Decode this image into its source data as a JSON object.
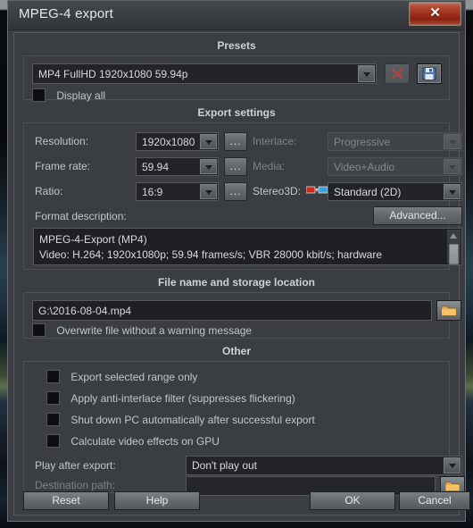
{
  "window": {
    "title": "MPEG-4 export",
    "close_label": "✕"
  },
  "presets": {
    "group_title": "Presets",
    "selected": "MP4 FullHD 1920x1080 59.94p",
    "delete_icon": "x-icon",
    "save_icon": "floppy-disk-icon",
    "display_all_label": "Display all",
    "display_all_checked": false
  },
  "export_settings": {
    "group_title": "Export settings",
    "resolution_label": "Resolution:",
    "resolution_value": "1920x1080",
    "frame_rate_label": "Frame rate:",
    "frame_rate_value": "59.94",
    "ratio_label": "Ratio:",
    "ratio_value": "16:9",
    "dots_label": "...",
    "interlace_label": "Interlace:",
    "interlace_value": "Progressive",
    "media_label": "Media:",
    "media_value": "Video+Audio",
    "stereo3d_label": "Stereo3D:",
    "stereo3d_icon": "anaglyph-glasses-icon",
    "stereo3d_value": "Standard (2D)",
    "format_description_label": "Format description:",
    "advanced_label": "Advanced...",
    "format_description_text": "MPEG-4-Export (MP4)\nVideo: H.264; 1920x1080p; 59.94 frames/s; VBR 28000 kbit/s; hardware"
  },
  "file_location": {
    "group_title": "File name and storage location",
    "path_value": "G:\\2016-08-04.mp4",
    "browse_icon": "folder-icon",
    "overwrite_label": "Overwrite file without a warning message",
    "overwrite_checked": false
  },
  "other": {
    "group_title": "Other",
    "checkboxes": [
      {
        "label": "Export selected range only",
        "checked": false
      },
      {
        "label": "Apply anti-interlace filter (suppresses flickering)",
        "checked": false
      },
      {
        "label": "Shut down PC automatically after successful export",
        "checked": false
      },
      {
        "label": "Calculate video effects on GPU",
        "checked": false
      }
    ],
    "play_after_export_label": "Play after export:",
    "play_after_export_value": "Don't play out",
    "destination_path_label": "Destination path:",
    "destination_path_value": "",
    "destination_browse_icon": "folder-icon"
  },
  "footer": {
    "reset_label": "Reset",
    "help_label": "Help",
    "ok_label": "OK",
    "cancel_label": "Cancel"
  },
  "colors": {
    "dialog_bg": "#3a3d41",
    "field_bg": "#222427",
    "text": "#c8ccd0",
    "close_red": "#9a2d1a",
    "folder_orange": "#f0a83c"
  }
}
